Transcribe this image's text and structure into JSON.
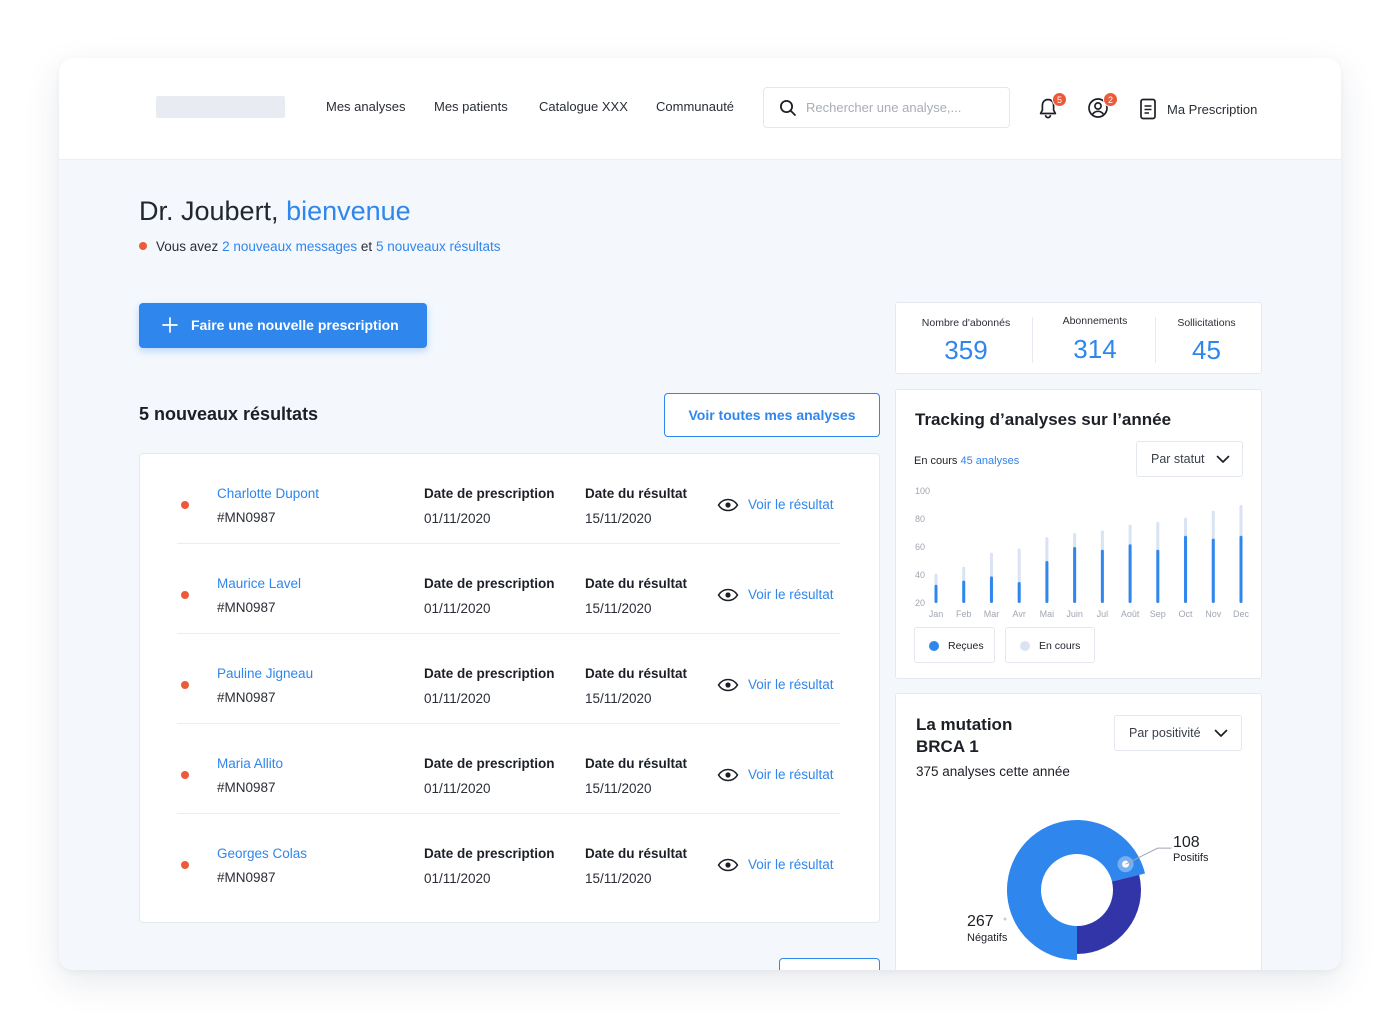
{
  "nav": {
    "items": [
      "Mes analyses",
      "Mes patients",
      "Catalogue XXX",
      "Communauté"
    ],
    "search_placeholder": "Rechercher une analyse,...",
    "notifications_count": "5",
    "account_count": "2",
    "prescription_label": "Ma Prescription"
  },
  "welcome": {
    "name": "Dr. Joubert,",
    "highlight": "bienvenue",
    "prefix": "Vous avez",
    "messages": "2 nouveaux messages",
    "connector": "et",
    "results": "5 nouveaux résultats"
  },
  "cta_label": "Faire une nouvelle prescription",
  "results_section": {
    "title": "5 nouveaux résultats",
    "view_all_label": "Voir toutes mes analyses",
    "prescription_header": "Date de prescription",
    "result_header": "Date du résultat",
    "view_label": "Voir le résultat",
    "rows": [
      {
        "name": "Charlotte Dupont",
        "id": "#MN0987",
        "prescription_date": "01/11/2020",
        "result_date": "15/11/2020"
      },
      {
        "name": "Maurice Lavel",
        "id": "#MN0987",
        "prescription_date": "01/11/2020",
        "result_date": "15/11/2020"
      },
      {
        "name": "Pauline Jigneau",
        "id": "#MN0987",
        "prescription_date": "01/11/2020",
        "result_date": "15/11/2020"
      },
      {
        "name": "Maria Allito",
        "id": "#MN0987",
        "prescription_date": "01/11/2020",
        "result_date": "15/11/2020"
      },
      {
        "name": "Georges Colas",
        "id": "#MN0987",
        "prescription_date": "01/11/2020",
        "result_date": "15/11/2020"
      }
    ]
  },
  "stats": [
    {
      "label": "Nombre d'abonnés",
      "value": "359"
    },
    {
      "label": "Abonnements",
      "value": "314"
    },
    {
      "label": "Sollicitations",
      "value": "45"
    }
  ],
  "tracking": {
    "title": "Tracking d’analyses sur l’année",
    "status_prefix": "En cours",
    "status_value": "45 analyses",
    "filter_label": "Par statut",
    "legend": [
      "Reçues",
      "En cours"
    ]
  },
  "mutation": {
    "title_line1": "La mutation",
    "title_line2": "BRCA 1",
    "subtitle": "375 analyses cette année",
    "filter_label": "Par positivité"
  },
  "colors": {
    "accent": "#2f86ec",
    "alert": "#ea5a3b",
    "light_bar": "#d9e3f3",
    "dark_slice": "#3235a8"
  },
  "icons": [
    "search-icon",
    "bell-icon",
    "user-icon",
    "document-icon",
    "plus-icon",
    "eye-icon",
    "chevron-down-icon"
  ],
  "chart_data": [
    {
      "type": "bar",
      "categories": [
        "Jan",
        "Feb",
        "Mar",
        "Avr",
        "Mai",
        "Juin",
        "Jul",
        "Août",
        "Sep",
        "Oct",
        "Nov",
        "Dec"
      ],
      "series": [
        {
          "name": "Reçues",
          "values": [
            33,
            36,
            39,
            35,
            50,
            60,
            58,
            62,
            58,
            68,
            66,
            68
          ]
        },
        {
          "name": "En cours",
          "values": [
            41,
            46,
            56,
            59,
            67,
            70,
            72,
            76,
            78,
            81,
            86,
            90
          ]
        }
      ],
      "yticks": [
        20,
        40,
        60,
        80,
        100
      ],
      "ylim": [
        20,
        100
      ],
      "title": "Tracking d’analyses sur l’année",
      "xlabel": "",
      "ylabel": "",
      "grid": false
    },
    {
      "type": "pie",
      "labels": [
        "Positifs",
        "Négatifs"
      ],
      "values": [
        108,
        267
      ],
      "colors": [
        "#2f86ec",
        "#3235a8"
      ],
      "title": "La mutation BRCA 1"
    }
  ]
}
